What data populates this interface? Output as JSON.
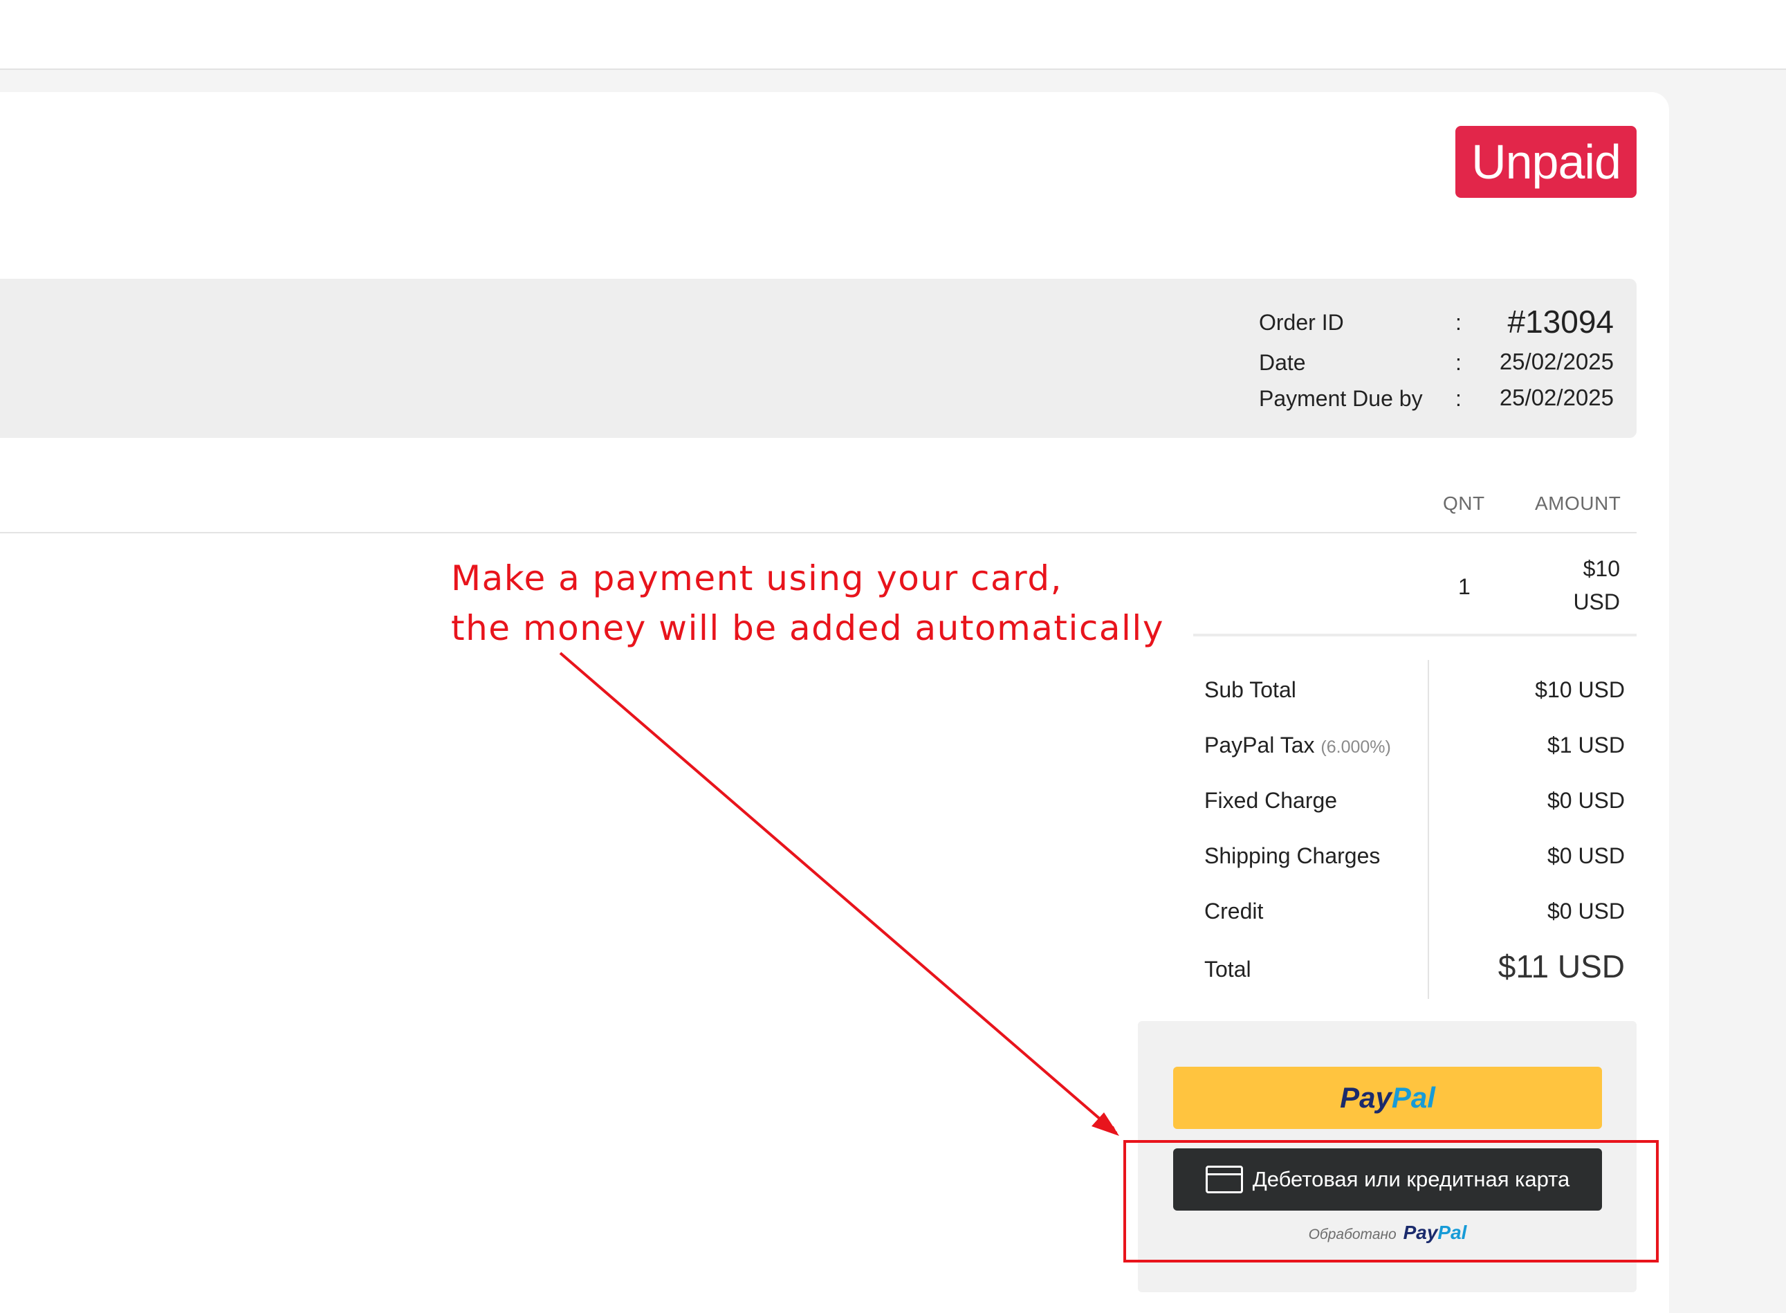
{
  "status": {
    "label": "Unpaid",
    "color": "#e2264a"
  },
  "order_info": [
    {
      "label": "Order ID",
      "colon": ":",
      "value": "#13094"
    },
    {
      "label": "Date",
      "colon": ":",
      "value": "25/02/2025"
    },
    {
      "label": "Payment Due by",
      "colon": ":",
      "value": "25/02/2025"
    }
  ],
  "table": {
    "headers": {
      "qty": "QNT",
      "amount": "AMOUNT"
    },
    "rows": [
      {
        "qty": "1",
        "amount_line1": "$10",
        "amount_line2": "USD"
      }
    ]
  },
  "summary": {
    "sub_total": {
      "label": "Sub Total",
      "value": "$10 USD"
    },
    "tax": {
      "label": "PayPal Tax",
      "rate": "(6.000%)",
      "value": "$1 USD"
    },
    "fixed": {
      "label": "Fixed Charge",
      "value": "$0 USD"
    },
    "shipping": {
      "label": "Shipping Charges",
      "value": "$0 USD"
    },
    "credit": {
      "label": "Credit",
      "value": "$0 USD"
    },
    "total": {
      "label": "Total",
      "value": "$11 USD"
    }
  },
  "payment": {
    "paypal_pay": "Pay",
    "paypal_pal": "Pal",
    "card_button_label": "Дебетовая или кредитная карта",
    "powered_by": "Обработано",
    "powered_logo_pay": "Pay",
    "powered_logo_pal": "Pal",
    "paypal_button_color": "#ffc43f",
    "card_button_color": "#2c2e2f"
  },
  "annotation": {
    "line1": "Make a payment using your card,",
    "line2": "the money will be added automatically",
    "color": "#e8141c"
  },
  "icons": {
    "card": "credit-card-icon",
    "arrow": "arrow-icon"
  }
}
